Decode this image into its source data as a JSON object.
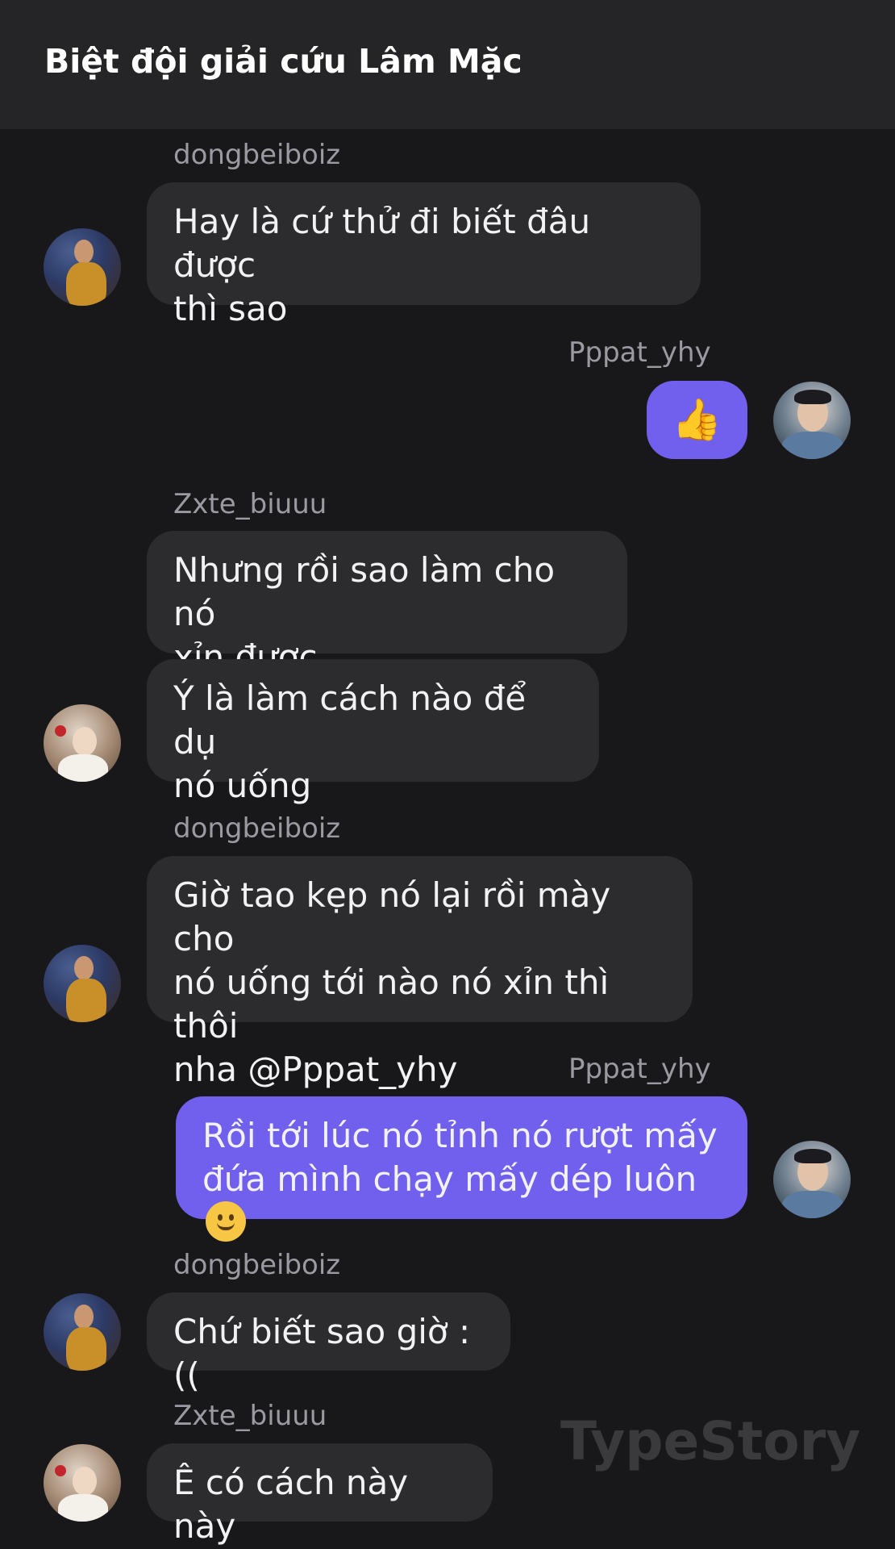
{
  "header": {
    "title": "Biệt đội giải cứu Lâm Mặc"
  },
  "messages": [
    {
      "sender": "dongbeiboiz",
      "lines": [
        "Hay là cứ thử đi biết đâu được",
        "thì sao"
      ]
    },
    {
      "sender": "Pppat_yhy",
      "emoji": "thumbs-up-icon"
    },
    {
      "sender": "Zxte_biuuu",
      "lines": [
        "Nhưng rồi sao làm cho nó",
        "xỉn được"
      ]
    },
    {
      "lines": [
        "Ý là làm cách nào để dụ",
        "nó uống"
      ]
    },
    {
      "sender": "dongbeiboiz",
      "lines": [
        "Giờ tao kẹp nó lại rồi mày cho",
        "nó uống tới nào nó xỉn thì thôi",
        "nha @Pppat_yhy"
      ]
    },
    {
      "sender": "Pppat_yhy",
      "lines": [
        "Rồi tới lúc nó tỉnh nó rượt mấy",
        "đứa mình chạy mấy dép luôn"
      ],
      "trailing_emoji": "slightly-smiling-face-icon"
    },
    {
      "sender": "dongbeiboiz",
      "lines": [
        "Chứ biết sao giờ :(("
      ]
    },
    {
      "sender": "Zxte_biuuu",
      "lines": [
        "Ê có cách này này"
      ]
    }
  ],
  "watermark": "TypeStory",
  "colors": {
    "background": "#18181a",
    "header": "#252527",
    "bubble_other": "#2c2c2e",
    "bubble_mine": "#7160ee",
    "sender_text": "#9a9aa0"
  }
}
